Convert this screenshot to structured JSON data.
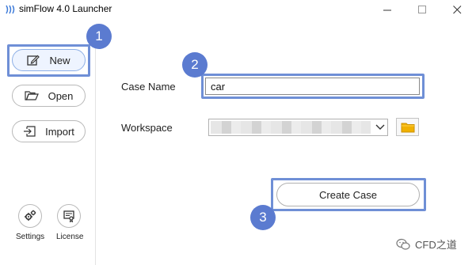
{
  "window": {
    "title": "simFlow 4.0 Launcher",
    "logo_icon": "simflow-logo-icon",
    "controls": [
      "minimize-icon",
      "maximize-icon",
      "close-icon"
    ]
  },
  "sidebar": {
    "new_label": "New",
    "open_label": "Open",
    "import_label": "Import",
    "settings_label": "Settings",
    "license_label": "License"
  },
  "form": {
    "case_name_label": "Case Name",
    "case_name_value": "car",
    "workspace_label": "Workspace",
    "workspace_value": "",
    "create_label": "Create Case"
  },
  "annotations": {
    "step1": "1",
    "step2": "2",
    "step3": "3"
  },
  "watermark": {
    "text": "CFD之道"
  },
  "colors": {
    "highlight": "#6f8fd6",
    "step_badge": "#5b7bd0",
    "folder": "#f0b000"
  }
}
